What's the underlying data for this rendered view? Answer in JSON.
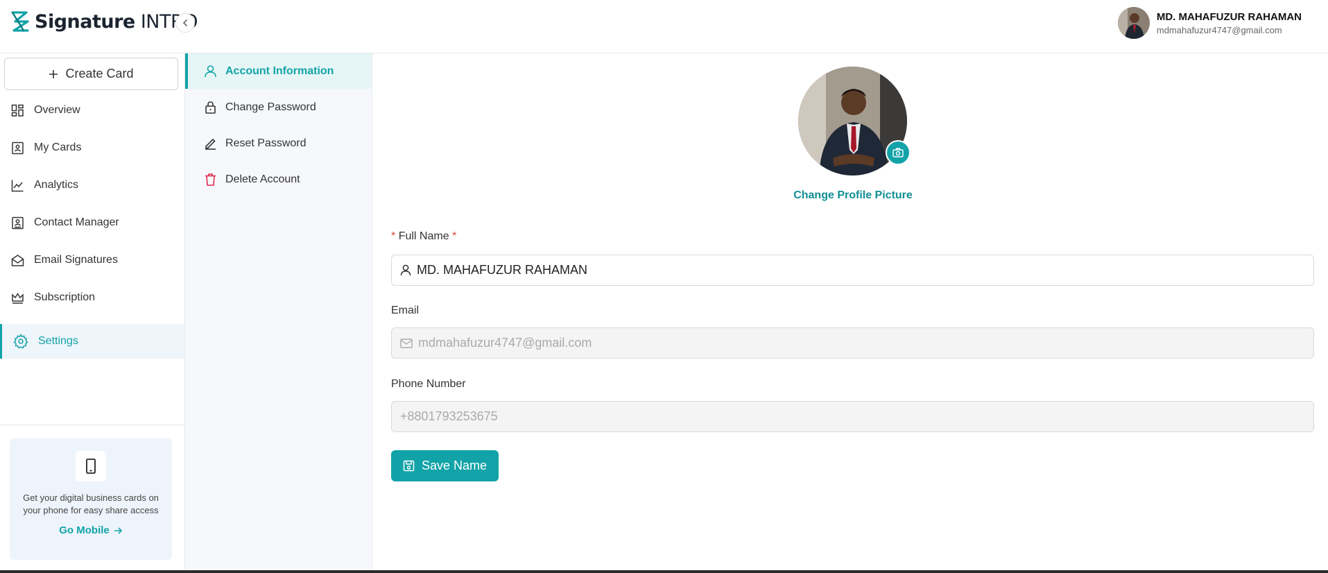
{
  "brand": {
    "name_bold": "Signature",
    "name_thin": "INTRO",
    "accent": "#12a3a8"
  },
  "user": {
    "name": "MD. MAHAFUZUR RAHAMAN",
    "email": "mdmahafuzur4747@gmail.com"
  },
  "sidebar": {
    "create_label": "Create Card",
    "items": [
      {
        "label": "Overview",
        "icon": "grid-icon"
      },
      {
        "label": "My Cards",
        "icon": "card-icon"
      },
      {
        "label": "Analytics",
        "icon": "chart-line-icon"
      },
      {
        "label": "Contact Manager",
        "icon": "contact-book-icon"
      },
      {
        "label": "Email Signatures",
        "icon": "envelope-open-icon"
      },
      {
        "label": "Subscription",
        "icon": "crown-icon"
      },
      {
        "label": "Settings",
        "icon": "gear-icon",
        "active": true
      }
    ],
    "promo": {
      "text": "Get your digital business cards on your phone for easy share access",
      "link": "Go Mobile"
    }
  },
  "settings_nav": [
    {
      "label": "Account Information",
      "icon": "user-icon",
      "active": true
    },
    {
      "label": "Change Password",
      "icon": "lock-icon"
    },
    {
      "label": "Reset Password",
      "icon": "pen-icon"
    },
    {
      "label": "Delete Account",
      "icon": "trash-icon"
    }
  ],
  "form": {
    "change_picture_label": "Change Profile Picture",
    "full_name": {
      "label": "Full Name",
      "required_mark": "*",
      "value": "MD. MAHAFUZUR RAHAMAN"
    },
    "email": {
      "label": "Email",
      "value": "mdmahafuzur4747@gmail.com"
    },
    "phone": {
      "label": "Phone Number",
      "value": "+8801793253675"
    },
    "save_label": "Save Name"
  }
}
